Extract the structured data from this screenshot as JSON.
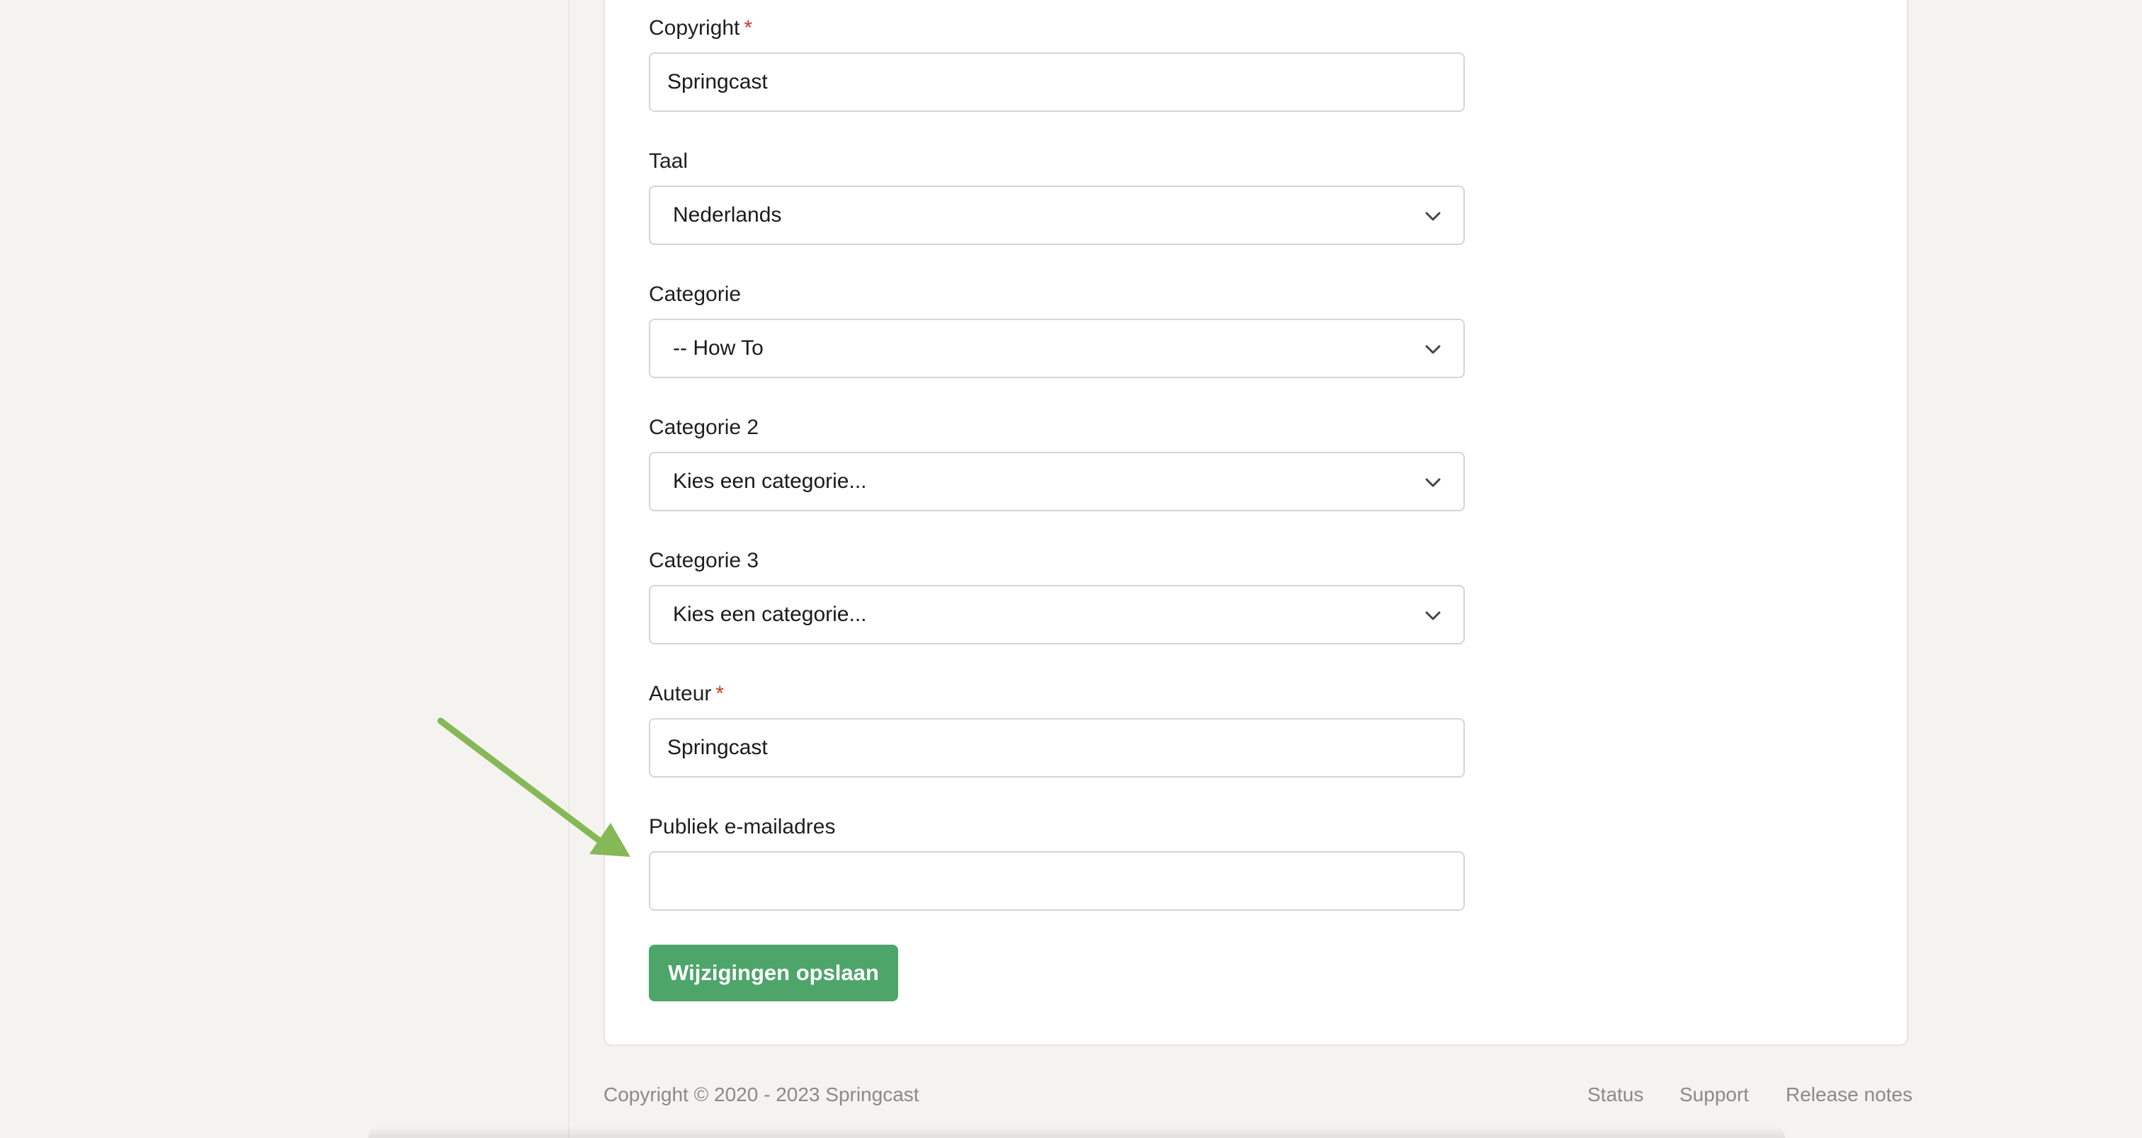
{
  "form": {
    "copyright": {
      "label": "Copyright",
      "required_mark": "*",
      "value": "Springcast"
    },
    "language": {
      "label": "Taal",
      "selected": "Nederlands"
    },
    "category": {
      "label": "Categorie",
      "selected": "-- How To"
    },
    "category2": {
      "label": "Categorie 2",
      "selected": "Kies een categorie..."
    },
    "category3": {
      "label": "Categorie 3",
      "selected": "Kies een categorie..."
    },
    "author": {
      "label": "Auteur",
      "required_mark": "*",
      "value": "Springcast"
    },
    "public_email": {
      "label": "Publiek e-mailadres",
      "value": ""
    },
    "save_label": "Wijzigingen opslaan"
  },
  "footer": {
    "copyright": "Copyright © 2020 - 2023 Springcast",
    "links": {
      "status": "Status",
      "support": "Support",
      "release_notes": "Release notes"
    }
  },
  "colors": {
    "accent_green": "#4da56a",
    "arrow_green": "#86b857",
    "required_red": "#d9342b"
  }
}
